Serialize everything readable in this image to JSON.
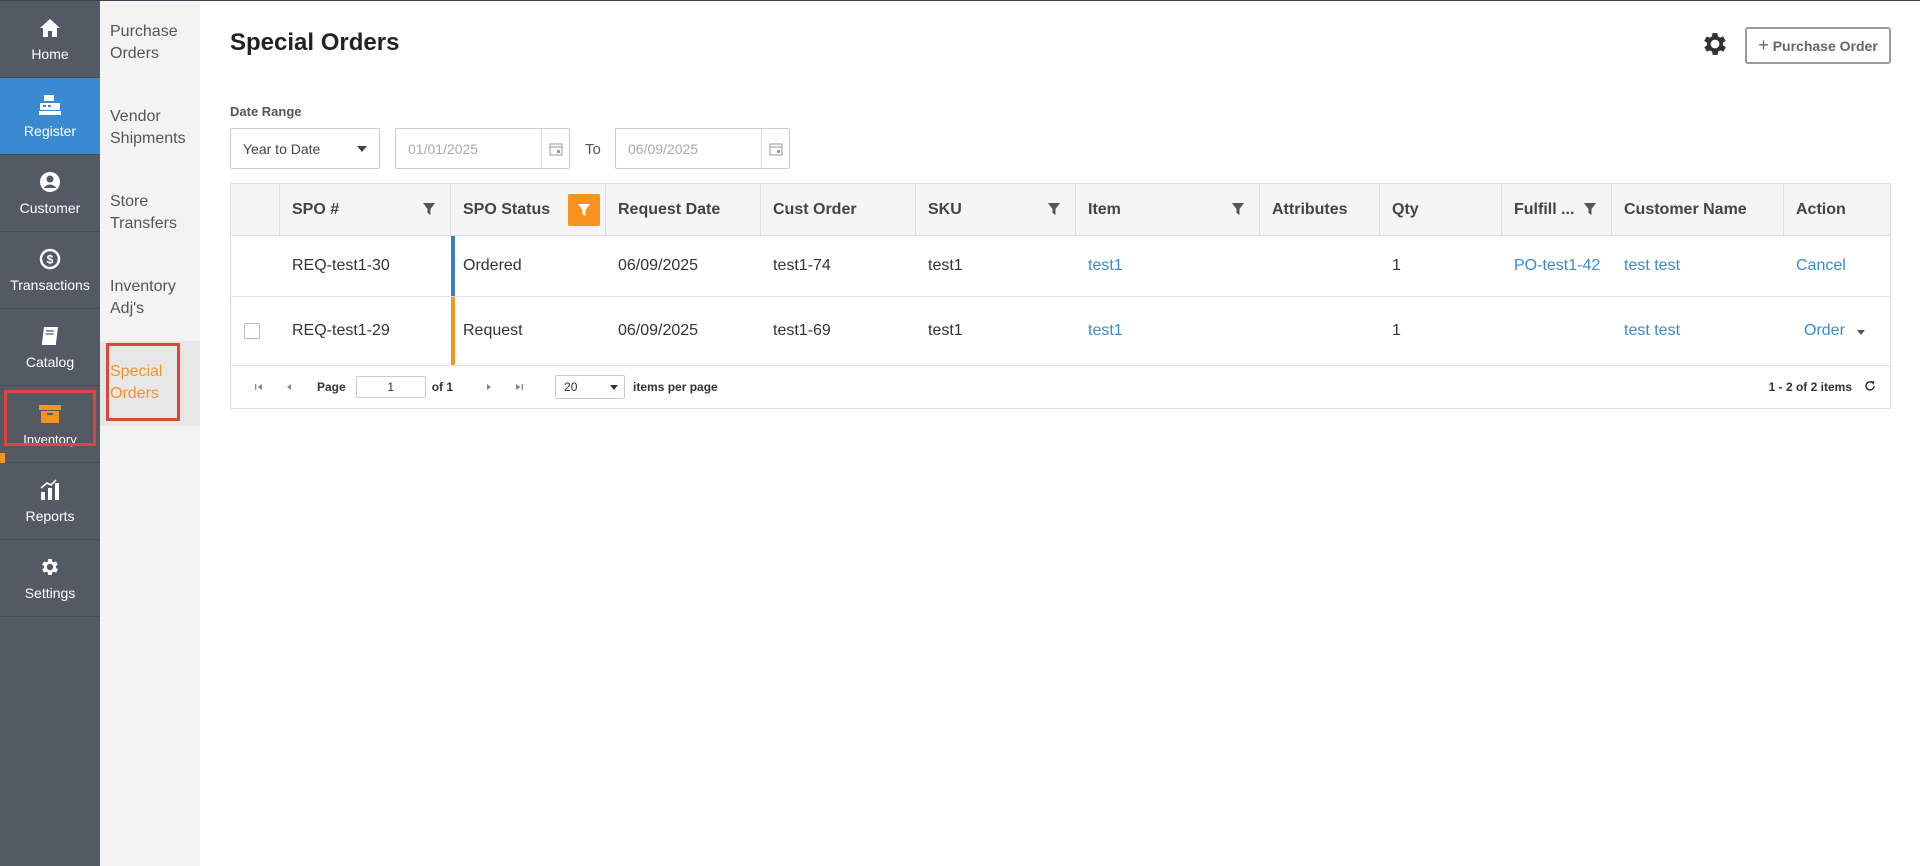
{
  "nav": {
    "items": [
      {
        "label": "Home",
        "icon": "home-icon"
      },
      {
        "label": "Register",
        "icon": "register-icon"
      },
      {
        "label": "Customer",
        "icon": "customer-icon"
      },
      {
        "label": "Transactions",
        "icon": "transactions-icon"
      },
      {
        "label": "Catalog",
        "icon": "catalog-icon"
      },
      {
        "label": "Inventory",
        "icon": "inventory-icon"
      },
      {
        "label": "Reports",
        "icon": "reports-icon"
      },
      {
        "label": "Settings",
        "icon": "settings-icon"
      }
    ]
  },
  "submenu": {
    "items": [
      {
        "label": "Purchase Orders"
      },
      {
        "label": "Vendor Shipments"
      },
      {
        "label": "Store Transfers"
      },
      {
        "label": "Inventory Adj's"
      },
      {
        "label": "Special Orders"
      }
    ]
  },
  "header": {
    "title": "Special Orders",
    "new_po_label": "Purchase Order"
  },
  "filters": {
    "date_range_label": "Date Range",
    "range_value": "Year to Date",
    "start_date": "01/01/2025",
    "to_label": "To",
    "end_date": "06/09/2025"
  },
  "grid": {
    "columns": [
      "SPO #",
      "SPO Status",
      "Request Date",
      "Cust Order",
      "SKU",
      "Item",
      "Attributes",
      "Qty",
      "Fulfill ...",
      "Customer Name",
      "Action"
    ],
    "rows": [
      {
        "spo": "REQ-test1-30",
        "status": "Ordered",
        "status_color": "#3a7fc1",
        "request_date": "06/09/2025",
        "cust_order": "test1-74",
        "sku": "test1",
        "item": "test1",
        "attributes": "",
        "qty": "1",
        "fulfill": "PO-test1-42",
        "customer": "test test",
        "action": "Cancel"
      },
      {
        "spo": "REQ-test1-29",
        "status": "Request",
        "status_color": "#f7941d",
        "request_date": "06/09/2025",
        "cust_order": "test1-69",
        "sku": "test1",
        "item": "test1",
        "attributes": "",
        "qty": "1",
        "fulfill": "",
        "customer": "test test",
        "action": "Order"
      }
    ]
  },
  "pager": {
    "page_label": "Page",
    "page_value": "1",
    "of_label": "of 1",
    "page_size": "20",
    "per_page_label": "items per page",
    "summary": "1 - 2 of 2 items"
  },
  "colors": {
    "accent": "#f7941d",
    "link": "#3a8ad2",
    "nav_bg": "#535a64",
    "highlight": "#e0453a"
  }
}
